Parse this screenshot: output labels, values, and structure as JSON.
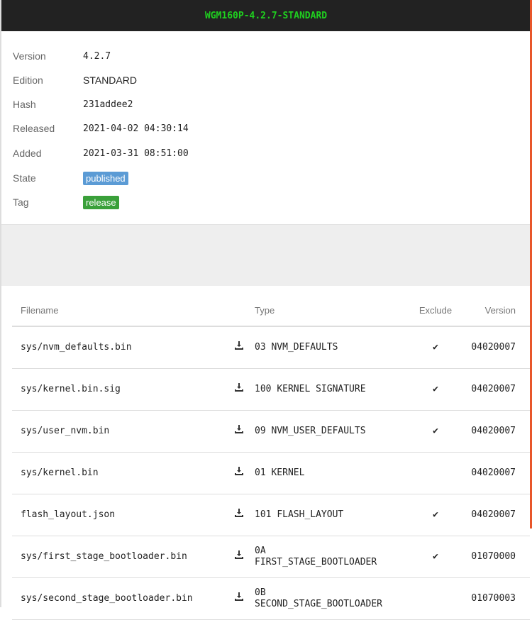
{
  "header": {
    "title": "WGM160P-4.2.7-STANDARD"
  },
  "info": [
    {
      "label": "Version",
      "value": "4.2.7"
    },
    {
      "label": "Edition",
      "value": "STANDARD"
    },
    {
      "label": "Hash",
      "value": "231addee2"
    },
    {
      "label": "Released",
      "value": "2021-04-02 04:30:14"
    },
    {
      "label": "Added",
      "value": "2021-03-31 08:51:00"
    }
  ],
  "state": {
    "label": "State",
    "value": "published",
    "color": "#5b9bd5"
  },
  "tag": {
    "label": "Tag",
    "value": "release",
    "color": "#3aa03a"
  },
  "table": {
    "headers": {
      "filename": "Filename",
      "type": "Type",
      "exclude": "Exclude",
      "version": "Version"
    },
    "rows": [
      {
        "filename": "sys/nvm_defaults.bin",
        "type_code": "03",
        "type_name": "NVM_DEFAULTS",
        "exclude": "✔",
        "version": "04020007"
      },
      {
        "filename": "sys/kernel.bin.sig",
        "type_code": "100",
        "type_name": "KERNEL SIGNATURE",
        "exclude": "✔",
        "version": "04020007"
      },
      {
        "filename": "sys/user_nvm.bin",
        "type_code": "09",
        "type_name": "NVM_USER_DEFAULTS",
        "exclude": "✔",
        "version": "04020007"
      },
      {
        "filename": "sys/kernel.bin",
        "type_code": "01",
        "type_name": "KERNEL",
        "exclude": "",
        "version": "04020007"
      },
      {
        "filename": "flash_layout.json",
        "type_code": "101",
        "type_name": "FLASH_LAYOUT",
        "exclude": "✔",
        "version": "04020007"
      },
      {
        "filename": "sys/first_stage_bootloader.bin",
        "type_code": "0A",
        "type_name": "FIRST_STAGE_BOOTLOADER",
        "exclude": "✔",
        "version": "01070000"
      },
      {
        "filename": "sys/second_stage_bootloader.bin",
        "type_code": "0B",
        "type_name": "SECOND_STAGE_BOOTLOADER",
        "exclude": "",
        "version": "01070003"
      }
    ]
  }
}
